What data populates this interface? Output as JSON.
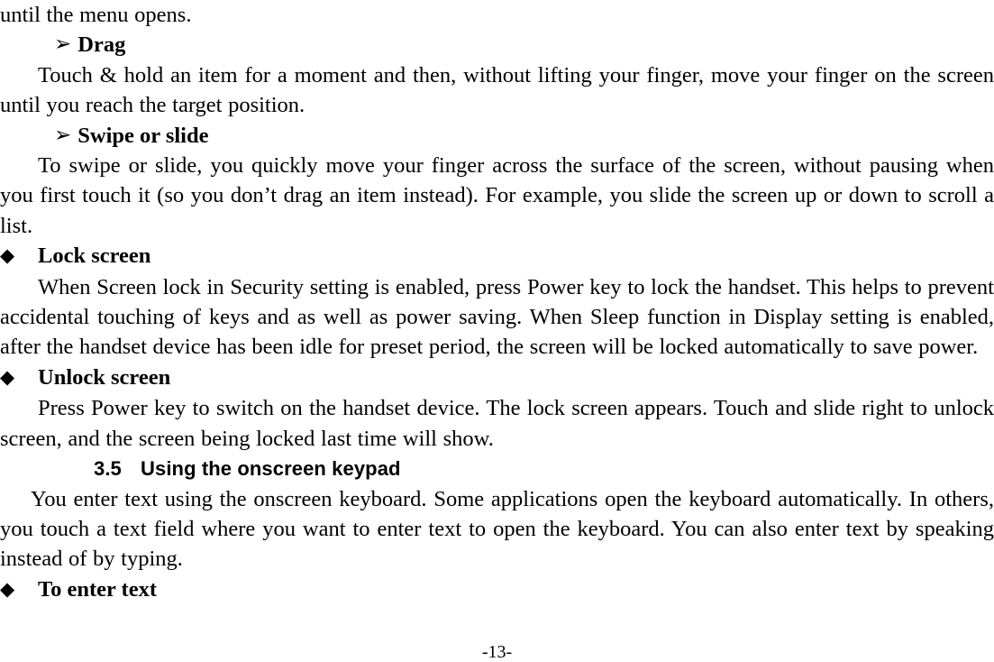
{
  "document": {
    "page_number_label": "-13-",
    "bullets": {
      "arrow": "➢",
      "diamond": "◆"
    }
  },
  "blocks": [
    {
      "type": "paragraph",
      "name": "continued-paragraph-menu-opens",
      "text": "until the menu opens."
    },
    {
      "type": "arrow-heading",
      "name": "heading-drag",
      "text": "Drag"
    },
    {
      "type": "paragraph",
      "name": "paragraph-drag-description",
      "text": "Touch & hold an item for a moment and then, without lifting your finger, move your finger on the screen until you reach the target position."
    },
    {
      "type": "arrow-heading",
      "name": "heading-swipe-or-slide",
      "text": "Swipe or slide"
    },
    {
      "type": "paragraph",
      "name": "paragraph-swipe-description",
      "text": "To swipe or slide, you quickly move your finger across the surface of the screen, without pausing when you first touch it (so you don’t drag an item instead). For example, you slide the screen up or down to scroll a list."
    },
    {
      "type": "diamond-heading",
      "name": "heading-lock-screen",
      "text": "Lock screen"
    },
    {
      "type": "paragraph",
      "name": "paragraph-lock-screen-description",
      "text": "When Screen lock in Security setting is enabled, press Power key to lock the handset. This helps to prevent accidental touching of keys and as well as power saving. When Sleep function in Display setting is enabled, after the handset device has been idle for preset period, the screen will be locked automatically to save power."
    },
    {
      "type": "diamond-heading",
      "name": "heading-unlock-screen",
      "text": "Unlock screen"
    },
    {
      "type": "paragraph",
      "name": "paragraph-unlock-screen-description",
      "text": "Press Power key to switch on the handset device. The lock screen appears. Touch and slide right to unlock screen, and the screen being locked last time will show."
    },
    {
      "type": "section-heading",
      "name": "heading-3-5-using-the-onscreen-keypad",
      "number": "3.5",
      "text": "Using the onscreen keypad"
    },
    {
      "type": "paragraph",
      "name": "paragraph-onscreen-keyboard-description",
      "text": "You enter text using the onscreen keyboard. Some applications open the keyboard automatically. In others, you touch a text field where you want to enter text to open the keyboard. You can also enter text by speaking instead of by typing."
    },
    {
      "type": "diamond-heading",
      "name": "heading-to-enter-text",
      "text": "To enter text"
    }
  ]
}
